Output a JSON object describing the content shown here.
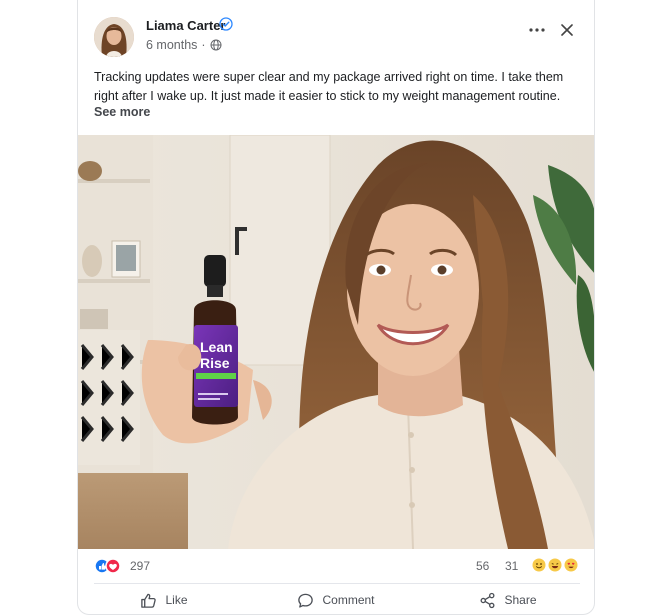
{
  "post": {
    "author": "Liama Carter",
    "time": "6 months",
    "text": "Tracking updates were super clear and my package arrived right on time. I take them right after I wake up. It just made it easier to stick to my weight management routine.",
    "see_more": "See more"
  },
  "product": {
    "brand_line1": "Lean",
    "brand_line2": "Rise"
  },
  "stats": {
    "reactions": "297",
    "comments": "56",
    "shares": "31"
  },
  "actions": {
    "like": "Like",
    "comment": "Comment",
    "share": "Share"
  },
  "icons": {
    "verified": "verified-badge-icon",
    "privacy": "globe-icon",
    "more": "more-dots-icon",
    "close": "close-icon",
    "like": "thumbs-up-icon",
    "comment": "speech-bubble-icon",
    "share": "share-nodes-icon"
  },
  "colors": {
    "verified": "#2d88ff",
    "like_reaction": "#1877f2",
    "love_reaction": "#f0284a",
    "bottle_label": "#6b2fa8",
    "label_stripe": "#5fd148"
  }
}
